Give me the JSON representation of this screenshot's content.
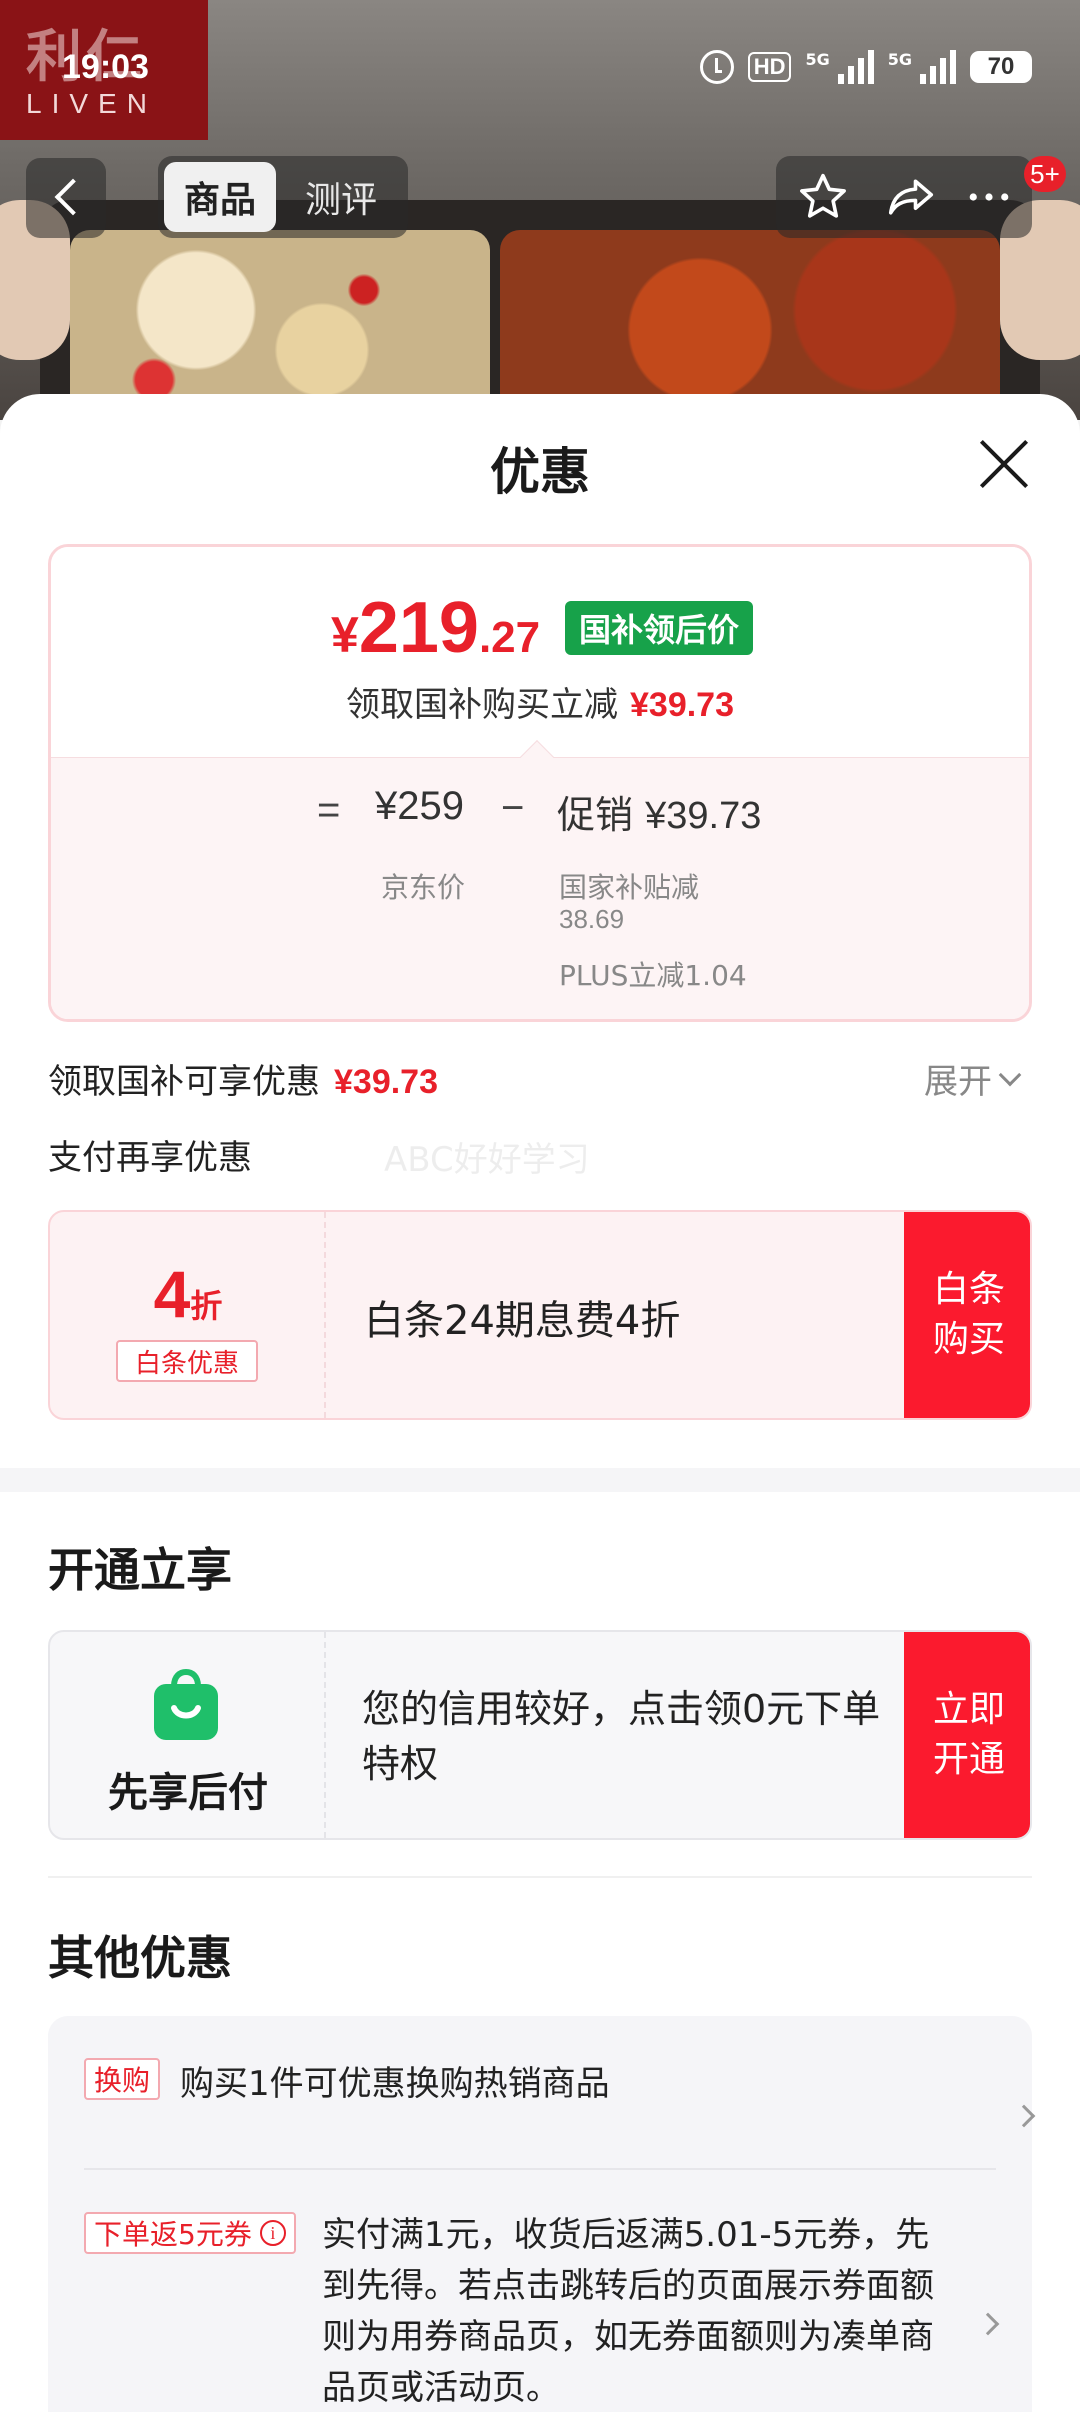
{
  "status_bar": {
    "time": "19:03",
    "hd": "HD",
    "sim1_label": "5G",
    "sim2_label": "5G",
    "battery": "70"
  },
  "brand": {
    "cn": "利仁",
    "en": "LIVEN"
  },
  "nav": {
    "tab_active": "商品",
    "tab_review": "测评",
    "badge": "5+"
  },
  "sheet": {
    "title": "优惠"
  },
  "price_card": {
    "currency": "¥",
    "price_int": "219",
    "price_dec": ".27",
    "tag": "国补领后价",
    "sub_text": "领取国补购买立减",
    "sub_amount": "¥39.73",
    "eq": "=",
    "jd_price": "¥259",
    "minus": "−",
    "promo_label": "促销",
    "promo_amount": "¥39.73",
    "jd_price_label": "京东价",
    "gov_label": "国家补贴减",
    "gov_value": "38.69",
    "plus_label": "PLUS立减1.04"
  },
  "gov_row": {
    "text": "领取国补可享优惠",
    "amount": "¥39.73",
    "expand": "展开"
  },
  "pay_row": {
    "text": "支付再享优惠",
    "watermark": "ABC好好学习"
  },
  "baitiao": {
    "discount_num": "4",
    "discount_unit": "折",
    "tag": "白条优惠",
    "text": "白条24期息费4折",
    "button": "白条\n购买"
  },
  "open_section": {
    "title": "开通立享",
    "name": "先享后付",
    "text": "您的信用较好，点击领0元下单特权",
    "button": "立即\n开通"
  },
  "other_section": {
    "title": "其他优惠",
    "items": [
      {
        "tag": "换购",
        "text": "购买1件可优惠换购热销商品"
      },
      {
        "tag": "下单返5元券",
        "text": "实付满1元，收货后返满5.01-5元券，先到先得。若点击跳转后的页面展示券面额则为用券商品页，如无券面额则为凑单商品页或活动页。"
      }
    ]
  },
  "colors": {
    "accent_red": "#e8202a",
    "button_red": "#fb1a2e",
    "green_tag": "#17a24a",
    "brand": "#8a1316"
  }
}
